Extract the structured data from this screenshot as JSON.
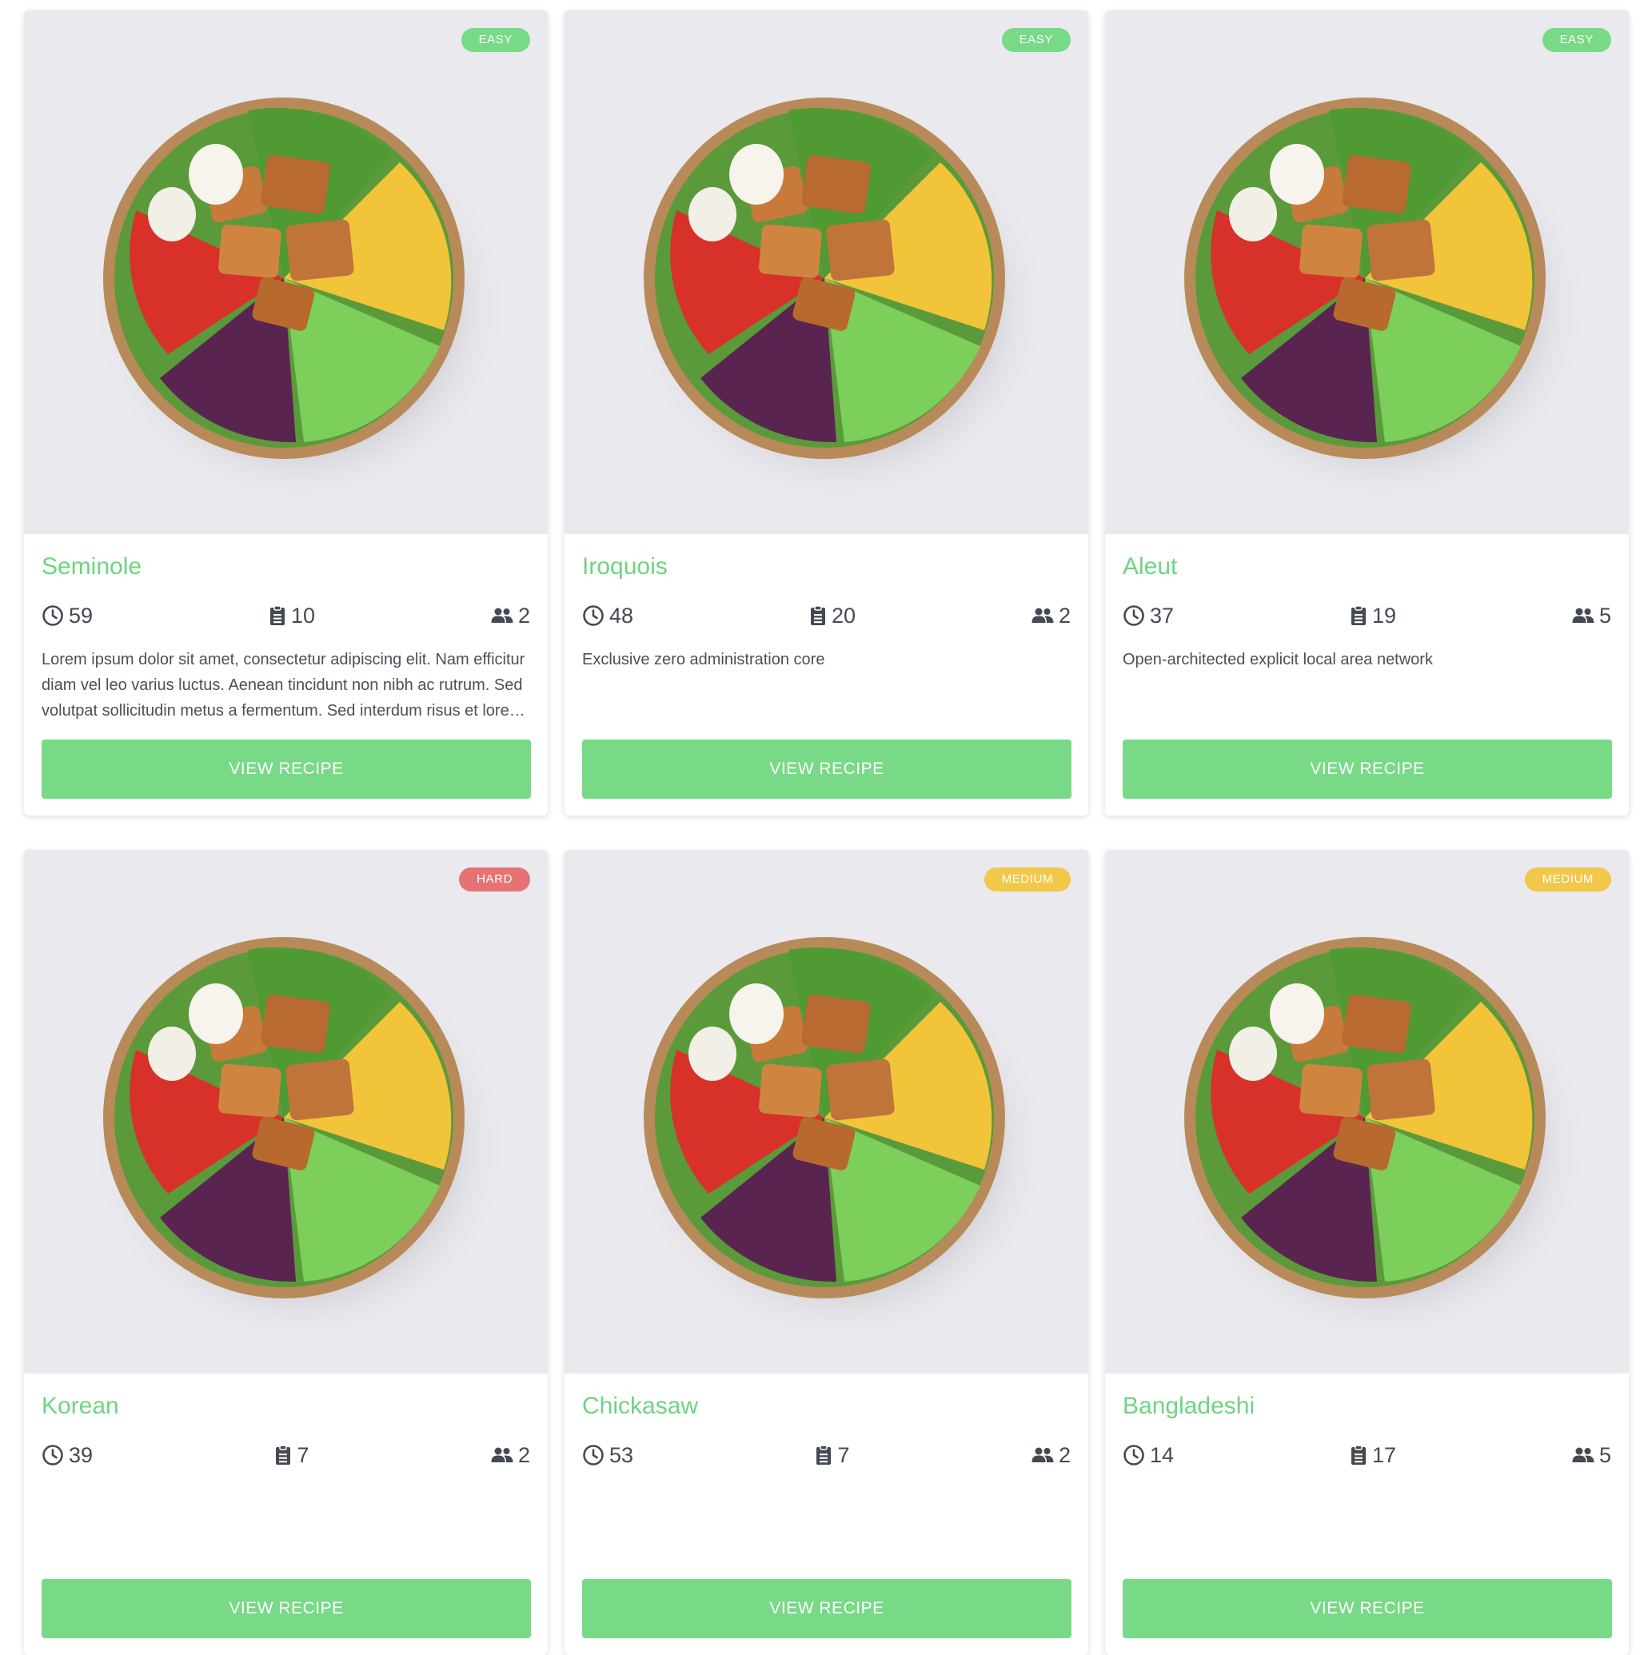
{
  "view_label": "View Recipe",
  "difficulty_colors": {
    "easy": "#78d987",
    "medium": "#f2c84b",
    "hard": "#e57373"
  },
  "accent": "#6fd47e",
  "icons": {
    "time": "clock-icon",
    "ingredients": "clipboard-icon",
    "servings": "people-icon"
  },
  "recipes": [
    {
      "difficulty": "Easy",
      "level": "easy",
      "name": "Seminole",
      "time": "59",
      "ingredients": "10",
      "servings": "2",
      "description": "Lorem ipsum dolor sit amet, consectetur adipiscing elit. Nam efficitur diam vel leo varius luctus. Aenean tincidunt non nibh ac rutrum. Sed volutpat sollicitudin metus a fermentum. Sed interdum risus et lorem tincidunt."
    },
    {
      "difficulty": "Easy",
      "level": "easy",
      "name": "Iroquois",
      "time": "48",
      "ingredients": "20",
      "servings": "2",
      "description": "Exclusive zero administration core"
    },
    {
      "difficulty": "Easy",
      "level": "easy",
      "name": "Aleut",
      "time": "37",
      "ingredients": "19",
      "servings": "5",
      "description": "Open-architected explicit local area network"
    },
    {
      "difficulty": "Hard",
      "level": "hard",
      "name": "Korean",
      "time": "39",
      "ingredients": "7",
      "servings": "2",
      "description": ""
    },
    {
      "difficulty": "Medium",
      "level": "medium",
      "name": "Chickasaw",
      "time": "53",
      "ingredients": "7",
      "servings": "2",
      "description": ""
    },
    {
      "difficulty": "Medium",
      "level": "medium",
      "name": "Bangladeshi",
      "time": "14",
      "ingredients": "17",
      "servings": "5",
      "description": ""
    }
  ]
}
